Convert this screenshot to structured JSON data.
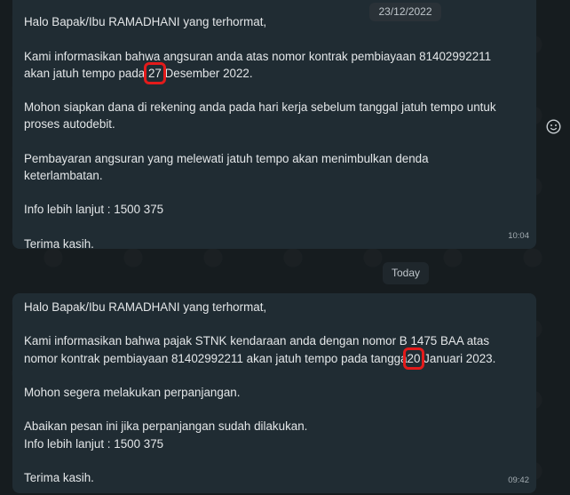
{
  "chat": {
    "date_badge": "23/12/2022",
    "today_badge": "Today",
    "messages": [
      {
        "greeting": "Halo Bapak/Ibu RAMADHANI yang terhormat,",
        "p1_line1": "Kami informasikan bahwa angsuran anda atas nomor kontrak pembiayaan 81402992211",
        "p1_line2_pre": "akan jatuh tempo pada ",
        "p1_line2_highlight": "27",
        "p1_line2_post": " Desember 2022.",
        "p2_line1": "Mohon siapkan dana di rekening anda pada hari kerja sebelum tanggal jatuh tempo untuk",
        "p2_line2": "proses autodebit.",
        "p3_line1": "Pembayaran angsuran yang melewati jatuh tempo akan menimbulkan denda",
        "p3_line2": "keterlambatan.",
        "info": "Info lebih lanjut : 1500 375",
        "closing": "Terima kasih.",
        "time": "10:04"
      },
      {
        "greeting": "Halo Bapak/Ibu RAMADHANI yang terhormat,",
        "p1_line1": "Kami informasikan bahwa pajak STNK kendaraan anda dengan nomor B 1475 BAA atas",
        "p1_line2_pre": "nomor kontrak pembiayaan 81402992211 akan jatuh tempo pada tangga",
        "p1_line2_highlight": "20",
        "p1_line2_post": " Januari 2023.",
        "p2": "Mohon segera melakukan perpanjangan.",
        "p3": "Abaikan pesan ini jika perpanjangan sudah dilakukan.",
        "info": "Info lebih lanjut : 1500 375",
        "closing": "Terima kasih.",
        "time": "09:42"
      }
    ]
  },
  "icons": {
    "emoji": "smiley-icon"
  },
  "colors": {
    "background": "#161c1f",
    "bubble": "#202c33",
    "highlight_box": "#e31b1b"
  }
}
